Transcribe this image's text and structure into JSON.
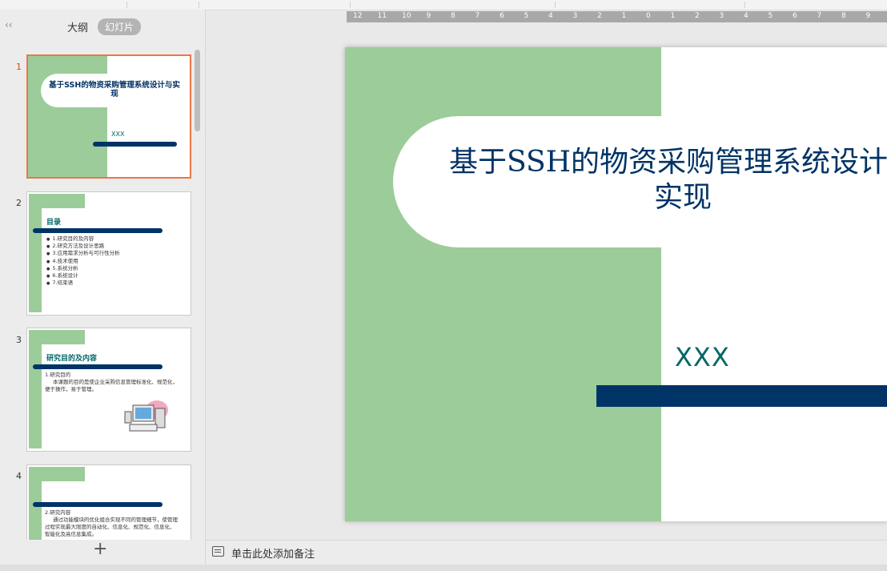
{
  "left_panel": {
    "collapse_label": "‹‹",
    "tabs": [
      "大纲",
      "幻灯片"
    ],
    "add_slide_label": "+"
  },
  "slides": [
    {
      "number": "1",
      "title": "基于SSH的物资采购管理系统设计与实现",
      "author": "XXX"
    },
    {
      "number": "2",
      "title": "目录",
      "items": [
        "1.研究目的及内容",
        "2.研究方法及设计思路",
        "3.应用需求分析与可行性分析",
        "4.技术使用",
        "5.系统分析",
        "6.系统设计",
        "7.结束语"
      ]
    },
    {
      "number": "3",
      "title": "研究目的及内容",
      "lines": [
        "1.研究目的",
        "本课题的目的是使企业采购信息管理标准化、规范化，便于操作，易于管理。"
      ]
    },
    {
      "number": "4",
      "lines": [
        "2.研究内容",
        "通过功能模块的优化组合实现不同的管理细节，使管理过程实现最大限度的自动化、信息化、规范化、信息化、智能化及高信息集成。"
      ]
    }
  ],
  "ruler_labels": [
    "12",
    "11",
    "10",
    "9",
    "8",
    "7",
    "6",
    "5",
    "4",
    "3",
    "2",
    "1",
    "0",
    "1",
    "2",
    "3",
    "4",
    "5",
    "6",
    "7",
    "8",
    "9"
  ],
  "main_slide": {
    "title_line1": "基于SSH的物资采购管理系统设计与",
    "title_line2": "实现",
    "author": "XXX"
  },
  "notes_placeholder": "单击此处添加备注",
  "colors": {
    "green": "#9ccc99",
    "navy": "#003366",
    "teal": "#006666",
    "selection": "#e8784a"
  }
}
